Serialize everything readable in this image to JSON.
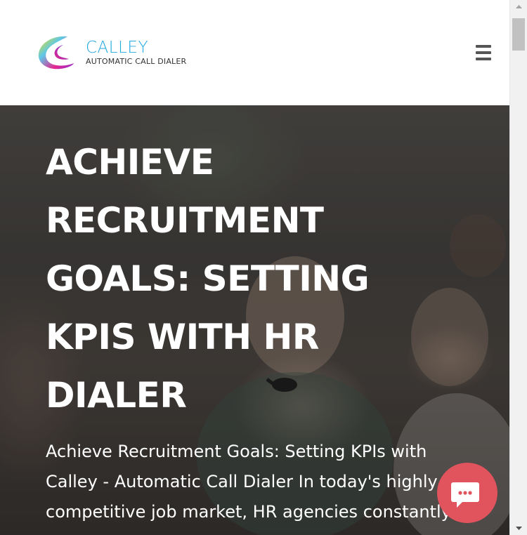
{
  "brand": {
    "name": "CALLEY",
    "tagline": "AUTOMATIC CALL DIALER"
  },
  "header": {
    "menu_icon": "hamburger-menu-icon"
  },
  "hero": {
    "title": "ACHIEVE RECRUITMENT GOALS: SETTING KPIS WITH HR DIALER",
    "intro": "Achieve Recruitment Goals: Setting KPIs with Calley - Automatic Call Dialer In today's highly competitive job market, HR agencies constantly"
  },
  "chat": {
    "icon": "chat-bubble-icon",
    "color": "#e1535d"
  },
  "colors": {
    "brand_blue": "#21a9e1",
    "menu_gray": "#555555"
  }
}
